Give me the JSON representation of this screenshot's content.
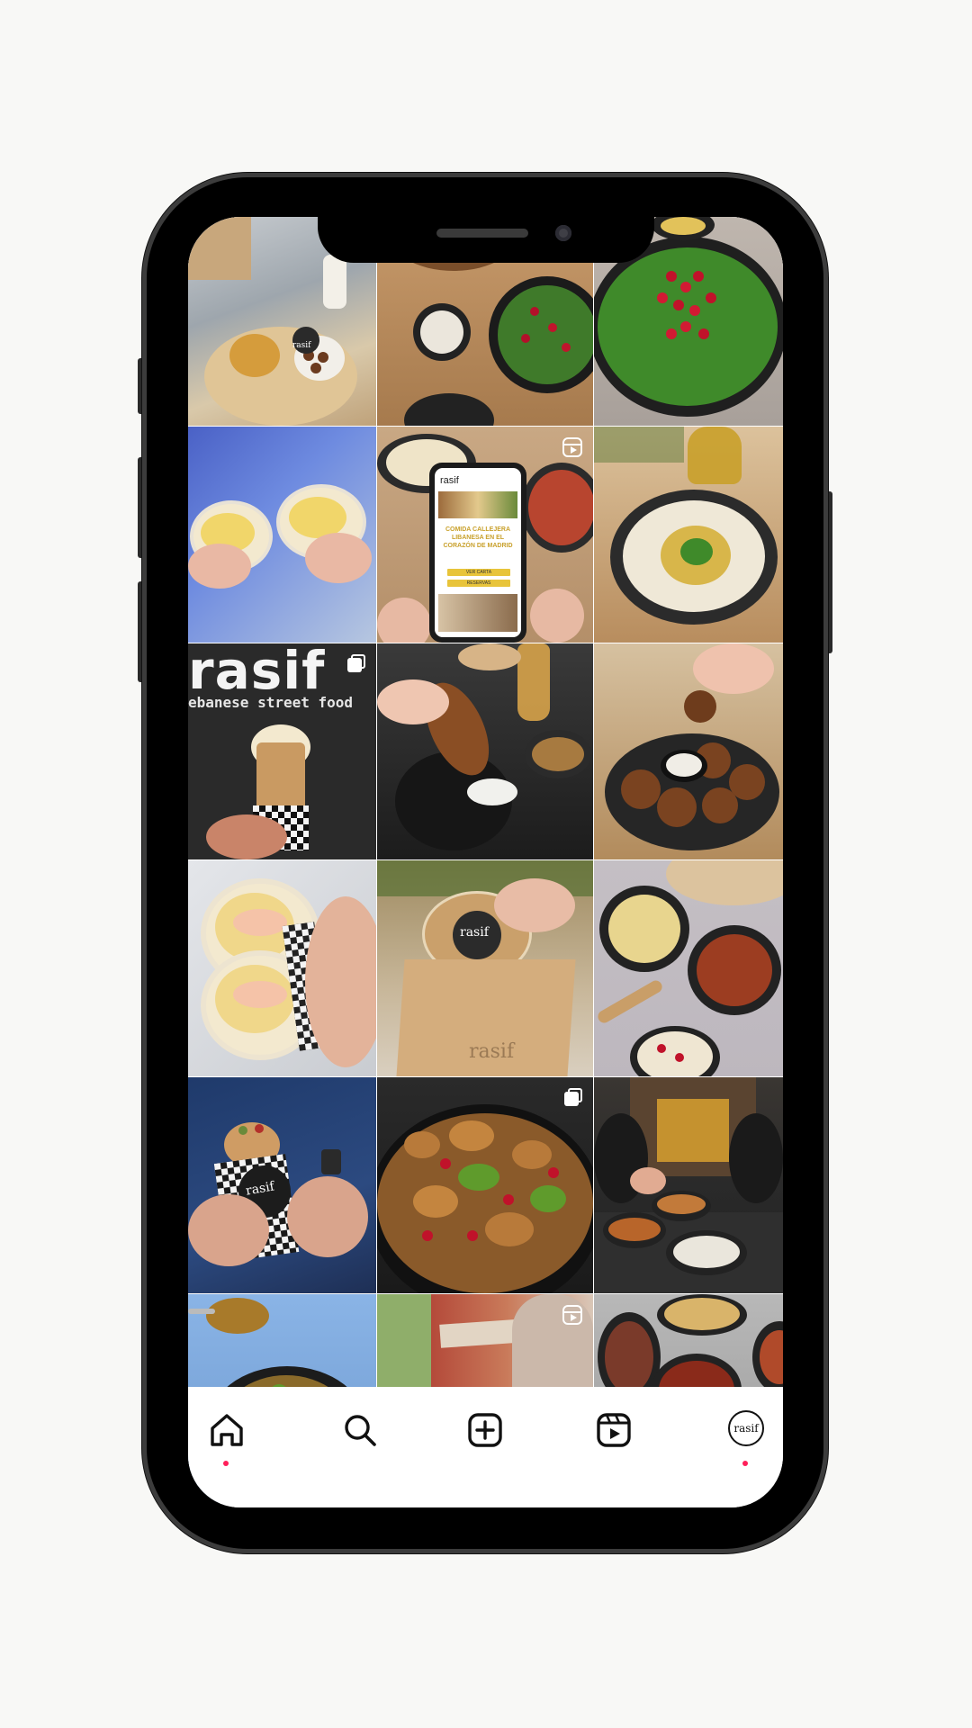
{
  "profile": {
    "brand": "rasif",
    "tagline": "ebanese street food"
  },
  "posts": [
    {
      "id": "post-1",
      "type": "photo",
      "subject": "takeaway-tray",
      "brand": "rasif"
    },
    {
      "id": "post-2",
      "type": "photo",
      "subject": "fattoush-tabbouleh-table"
    },
    {
      "id": "post-3",
      "type": "photo",
      "subject": "tabbouleh-pomegranate"
    },
    {
      "id": "post-4",
      "type": "photo",
      "subject": "wraps-held"
    },
    {
      "id": "post-5",
      "type": "reel",
      "subject": "website-on-phone",
      "screen_brand": "rasif",
      "screen_headline": "COMIDA CALLEJERA LIBANESA EN EL CORAZÓN DE MADRID",
      "screen_button_1": "VER CARTA",
      "screen_button_2": "RESERVAS"
    },
    {
      "id": "post-6",
      "type": "photo",
      "subject": "hummus-olive-oil"
    },
    {
      "id": "post-7",
      "type": "carousel",
      "subject": "wrap-with-sauce"
    },
    {
      "id": "post-8",
      "type": "photo",
      "subject": "kibbeh-dip"
    },
    {
      "id": "post-9",
      "type": "photo",
      "subject": "falafel-dip"
    },
    {
      "id": "post-10",
      "type": "photo",
      "subject": "chicken-wrap-cut"
    },
    {
      "id": "post-11",
      "type": "photo",
      "subject": "delivery-bag",
      "brand": "rasif"
    },
    {
      "id": "post-12",
      "type": "photo",
      "subject": "hummus-muhammara-bread"
    },
    {
      "id": "post-13",
      "type": "photo",
      "subject": "wrap-held-man",
      "brand": "rasif"
    },
    {
      "id": "post-14",
      "type": "carousel",
      "subject": "fattoush-salad"
    },
    {
      "id": "post-15",
      "type": "photo",
      "subject": "restaurant-table"
    },
    {
      "id": "post-16",
      "type": "photo",
      "subject": "bowl-dish"
    },
    {
      "id": "post-17",
      "type": "reel",
      "subject": "street-wall"
    },
    {
      "id": "post-18",
      "type": "photo",
      "subject": "mezze-dishes"
    }
  ],
  "nav": {
    "items": [
      {
        "name": "home",
        "icon": "home-icon",
        "active": true
      },
      {
        "name": "search",
        "icon": "search-icon"
      },
      {
        "name": "create",
        "icon": "plus-square-icon"
      },
      {
        "name": "reels",
        "icon": "reels-icon"
      },
      {
        "name": "profile",
        "icon": "profile-avatar",
        "label": "rasif",
        "notification": true
      }
    ]
  },
  "colors": {
    "background": "#f8f8f6",
    "phone_frame": "#000000",
    "notification_dot": "#ff1f5a"
  }
}
